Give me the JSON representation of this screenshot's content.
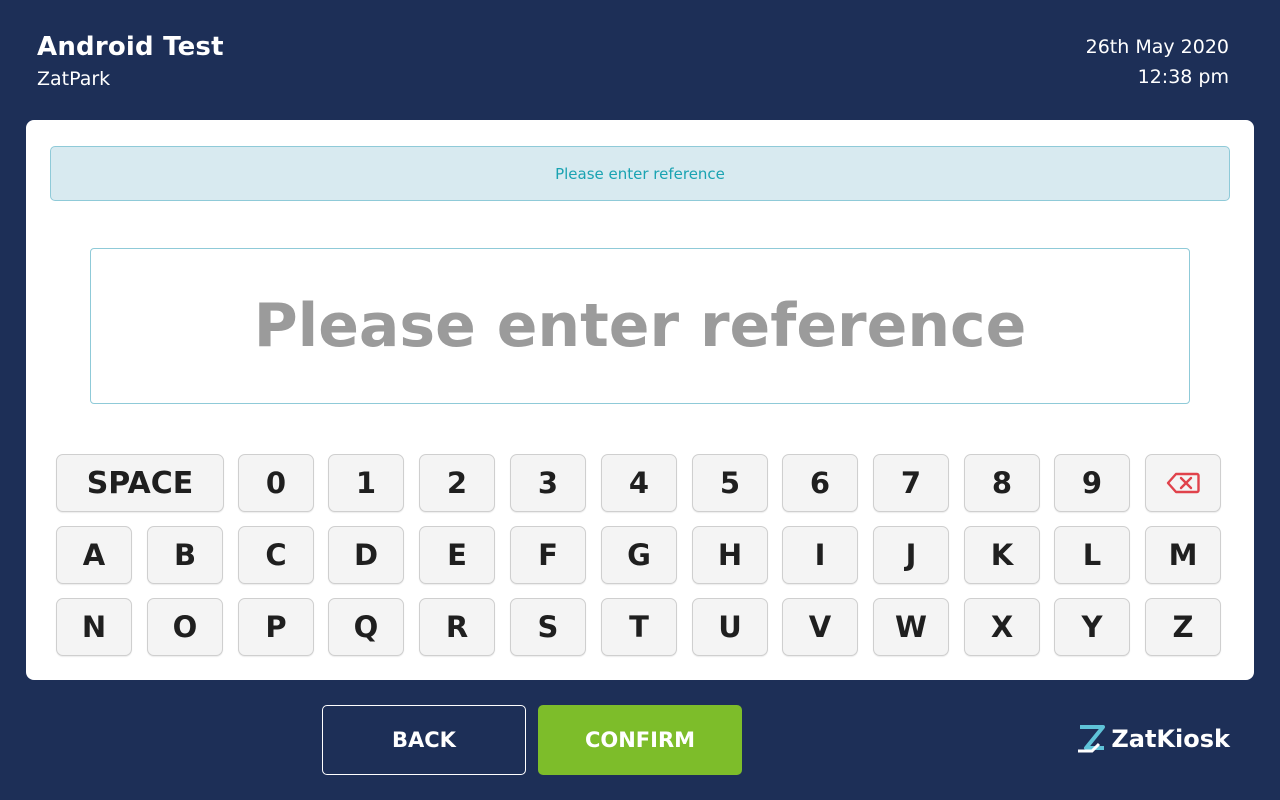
{
  "header": {
    "title": "Android Test",
    "subtitle": "ZatPark",
    "date": "26th May 2020",
    "time": "12:38 pm"
  },
  "prompt": {
    "banner_text": "Please enter reference",
    "input_placeholder": "Please enter reference"
  },
  "keyboard": {
    "row1": [
      "SPACE",
      "0",
      "1",
      "2",
      "3",
      "4",
      "5",
      "6",
      "7",
      "8",
      "9",
      "backspace-icon"
    ],
    "row2": [
      "A",
      "B",
      "C",
      "D",
      "E",
      "F",
      "G",
      "H",
      "I",
      "J",
      "K",
      "L",
      "M"
    ],
    "row3": [
      "N",
      "O",
      "P",
      "Q",
      "R",
      "S",
      "T",
      "U",
      "V",
      "W",
      "X",
      "Y",
      "Z"
    ]
  },
  "actions": {
    "back_label": "BACK",
    "confirm_label": "CONFIRM"
  },
  "brand": {
    "name": "ZatKiosk",
    "logo_icon": "zatkiosk-logo-icon"
  },
  "colors": {
    "background": "#1d2f57",
    "confirm": "#7dbd2a",
    "info_text": "#1aa3b2",
    "backspace": "#e0424b"
  }
}
